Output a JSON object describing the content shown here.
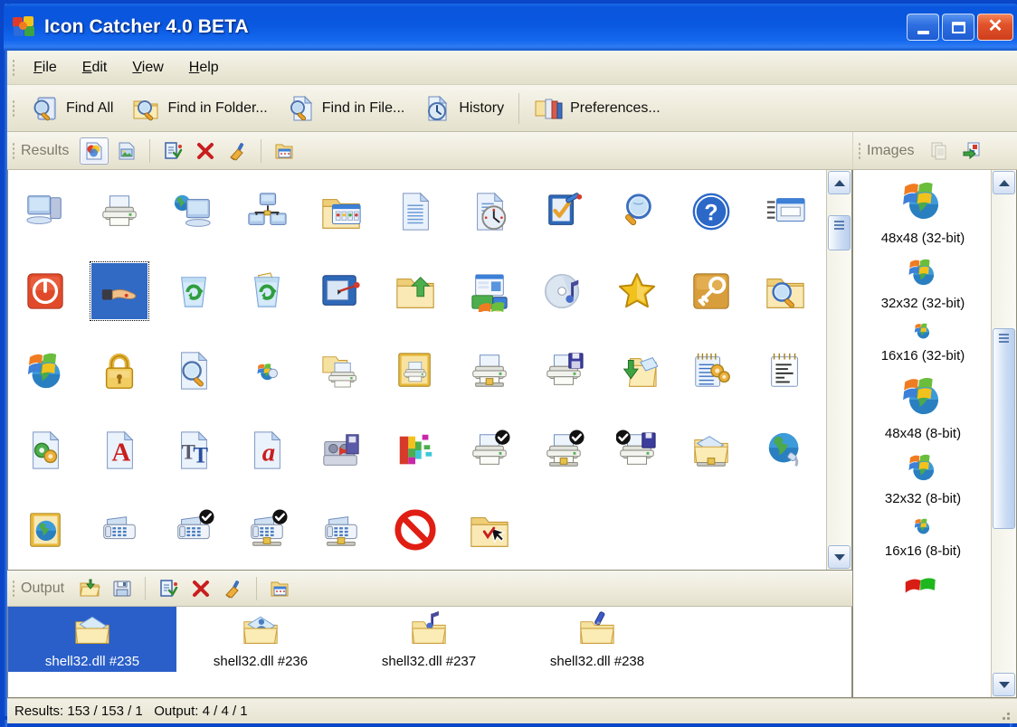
{
  "window": {
    "title": "Icon Catcher 4.0 BETA",
    "app_icon": "pinwheel-icon",
    "titlebar_color": "#0A57E0",
    "toolbar_color": "#ECE9D8",
    "selection_color": "#316AC5",
    "buttons": {
      "minimize": "_",
      "maximize": "□",
      "close": "✕"
    }
  },
  "menu": {
    "items": [
      {
        "label": "File",
        "accel": "F"
      },
      {
        "label": "Edit",
        "accel": "E"
      },
      {
        "label": "View",
        "accel": "V"
      },
      {
        "label": "Help",
        "accel": "H"
      }
    ]
  },
  "toolbar": {
    "buttons": [
      {
        "label": "Find All",
        "icon": "find-all-icon"
      },
      {
        "label": "Find in Folder...",
        "icon": "find-in-folder-icon"
      },
      {
        "label": "Find in File...",
        "icon": "find-in-file-icon"
      },
      {
        "label": "History",
        "icon": "history-icon"
      },
      {
        "label": "Preferences...",
        "icon": "preferences-icon"
      }
    ]
  },
  "results_panel": {
    "title": "Results",
    "tools": [
      {
        "name": "view-icons-button",
        "icon": "colored-page-icon",
        "selected": true
      },
      {
        "name": "view-images-button",
        "icon": "image-page-icon",
        "selected": false
      },
      {
        "name": "add-to-output-button",
        "icon": "add-to-output-icon",
        "selected": false
      },
      {
        "name": "delete-button",
        "icon": "red-x-icon",
        "selected": false
      },
      {
        "name": "clear-button",
        "icon": "broom-icon",
        "selected": false
      },
      {
        "name": "open-folder-button",
        "icon": "folder-window-icon",
        "selected": false
      }
    ],
    "scroll": {
      "position": 0.06,
      "thumb_size": 0.1
    },
    "icons": [
      "my-computer",
      "printer",
      "my-network-places",
      "network-workgroup",
      "folder-open-images",
      "document-lines",
      "document-clock",
      "checklist-pencil",
      "magnifier-globe",
      "help-question",
      "window-properties",
      "shutdown-power",
      "hand-offer",
      "recycle-bin-empty",
      "recycle-bin-full",
      "window-pointer",
      "folder-green-arrow",
      "start-menu-programs",
      "audio-cd",
      "favorites-star",
      "key-orange",
      "folder-search",
      "windows-globe-update",
      "padlock-gold",
      "document-search",
      "dial-up-small",
      "folder-printer",
      "folder-printer-gold",
      "printer-network",
      "printer-save",
      "folder-download",
      "notepad-settings",
      "notepad-text",
      "document-gears",
      "font-type1",
      "font-truetype",
      "document-italic-a",
      "tape-backup",
      "defrag-blocks",
      "printer-default",
      "printer-network-default",
      "printer-floppy-default",
      "folder-mail-network",
      "globe-connection",
      "address-book-globe",
      "fax-machine",
      "fax-default",
      "fax-network-default",
      "fax-network",
      "no-entry",
      "folder-select-cursor"
    ],
    "selected_index": 12,
    "checked_indices": [
      38,
      39,
      40,
      45,
      46
    ]
  },
  "images_panel": {
    "title": "Images",
    "tools": [
      {
        "name": "copy-button",
        "icon": "copy-icon",
        "enabled": false
      },
      {
        "name": "export-button",
        "icon": "export-green-icon",
        "enabled": true
      }
    ],
    "items": [
      {
        "label": "48x48 (32-bit)",
        "size": 48,
        "style": "full"
      },
      {
        "label": "32x32 (32-bit)",
        "size": 34,
        "style": "full"
      },
      {
        "label": "16x16 (32-bit)",
        "size": 20,
        "style": "full"
      },
      {
        "label": "48x48 (8-bit)",
        "size": 48,
        "style": "full"
      },
      {
        "label": "32x32 (8-bit)",
        "size": 34,
        "style": "full"
      },
      {
        "label": "16x16 (8-bit)",
        "size": 20,
        "style": "full"
      },
      {
        "label": "",
        "size": 44,
        "style": "flag"
      }
    ],
    "scroll": {
      "position": 0.28,
      "thumb_size": 0.42
    }
  },
  "output_panel": {
    "title": "Output",
    "tools": [
      {
        "name": "open-button",
        "icon": "folder-open-green-icon"
      },
      {
        "name": "save-button",
        "icon": "floppy-save-icon"
      },
      {
        "name": "add-button",
        "icon": "add-to-output-icon"
      },
      {
        "name": "delete-button",
        "icon": "red-x-icon"
      },
      {
        "name": "clear-button",
        "icon": "broom-icon"
      },
      {
        "name": "folder-button",
        "icon": "folder-window-icon"
      }
    ],
    "items": [
      {
        "label": "shell32.dll #235",
        "icon": "folder-envelope-icon",
        "selected": true
      },
      {
        "label": "shell32.dll #236",
        "icon": "folder-person-icon",
        "selected": false
      },
      {
        "label": "shell32.dll #237",
        "icon": "folder-music-icon",
        "selected": false
      },
      {
        "label": "shell32.dll #238",
        "icon": "folder-pen-icon",
        "selected": false
      }
    ]
  },
  "statusbar": {
    "text": "Results: 153 / 153 / 1   Output: 4 / 4 / 1"
  }
}
